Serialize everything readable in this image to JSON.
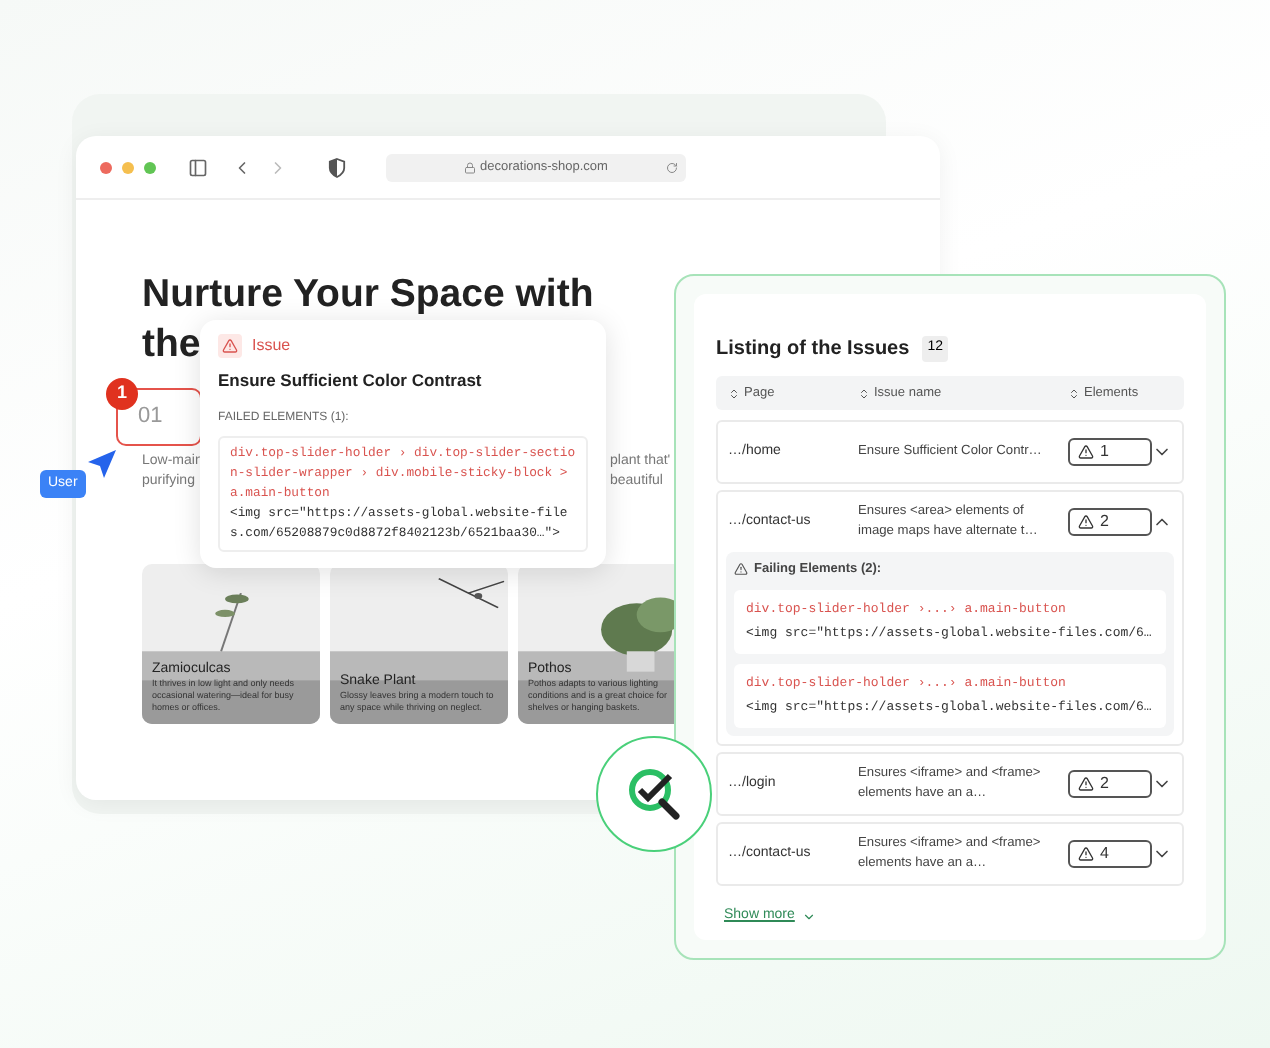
{
  "browser": {
    "url": "decorations-shop.com"
  },
  "hero": {
    "heading_line_1": "Nurture Your Space with",
    "heading_line_2": "the",
    "step_number": "01",
    "step_badge": "1",
    "intro_left": [
      "Low-main",
      "purifying"
    ],
    "intro_right": [
      "plant that'",
      "beautiful"
    ]
  },
  "cards": [
    {
      "title": "Zamioculcas",
      "text": "It thrives in low light and only needs occasional watering—ideal for busy homes or offices."
    },
    {
      "title": "Snake Plant",
      "text": "Glossy leaves bring a modern touch to any space while thriving on neglect."
    },
    {
      "title": "Pothos",
      "text": "Pothos adapts to various lighting conditions and is a great choice for shelves or hanging baskets."
    }
  ],
  "cursor": {
    "label": "User"
  },
  "issue_popup": {
    "tag": "Issue",
    "title": "Ensure Sufficient Color Contrast",
    "failed_label": "FAILED ELEMENTS (1):",
    "selector": "div.top-slider-holder › div.top-slider-section-slider-wrapper › div.mobile-sticky-block > a.main-button",
    "code": "<img src=\"https://assets-global.website-files.com/65208879c0d8872f8402123b/6521baa30…\">"
  },
  "issues": {
    "title": "Listing of the Issues",
    "count": "12",
    "columns": [
      "Page",
      "Issue name",
      "Elements"
    ],
    "rows": [
      {
        "page": "…/home",
        "issue": "Ensure Sufficient Color Contr…",
        "elements": "1",
        "expanded": false
      },
      {
        "page": "…/contact-us",
        "issue": "Ensures <area> elements of image maps have alternate t…",
        "elements": "2",
        "expanded": true,
        "failing_label": "Failing Elements (2):",
        "failing": [
          {
            "selector": "div.top-slider-holder ›...› a.main-button",
            "code": "<img src=\"https://assets-global.website-files.com/6…"
          },
          {
            "selector": "div.top-slider-holder ›...› a.main-button",
            "code": "<img src=\"https://assets-global.website-files.com/6…"
          }
        ]
      },
      {
        "page": "…/login",
        "issue": "Ensures <iframe> and <frame> elements have an a…",
        "elements": "2",
        "expanded": false
      },
      {
        "page": "…/contact-us",
        "issue": "Ensures <iframe> and <frame> elements have an a…",
        "elements": "4",
        "expanded": false
      }
    ],
    "show_more": "Show more"
  }
}
